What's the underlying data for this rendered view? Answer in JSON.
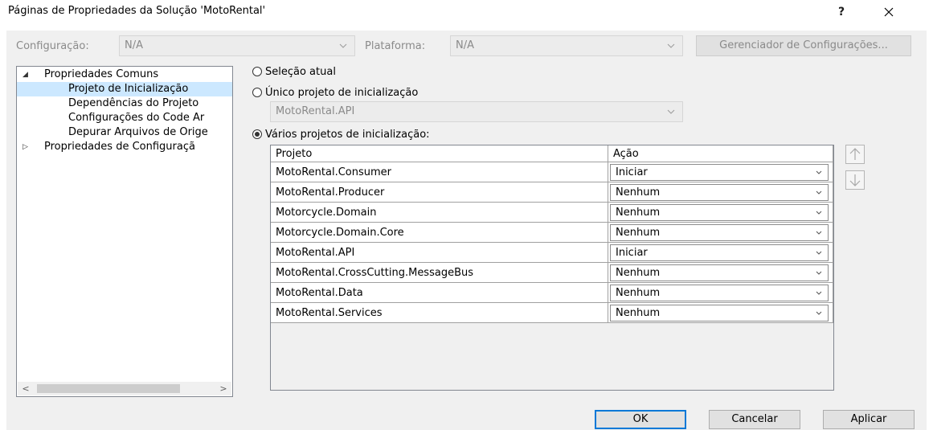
{
  "window": {
    "title": "Páginas de Propriedades da Solução 'MotoRental'",
    "help_label": "?"
  },
  "toolbar": {
    "config_label": "Configuração:",
    "config_value": "N/A",
    "platform_label": "Plataforma:",
    "platform_value": "N/A",
    "config_manager_label": "Gerenciador de Configurações..."
  },
  "tree": {
    "common": "Propriedades Comuns",
    "items": [
      "Projeto de Inicialização",
      "Dependências do Projeto",
      "Configurações do Code Ar",
      "Depurar Arquivos de Orige"
    ],
    "config": "Propriedades de Configuraçã",
    "selected_index": 0,
    "scroll_left": "<",
    "scroll_right": ">"
  },
  "startup": {
    "current_selection": "Seleção atual",
    "single_project": "Único projeto de inicialização",
    "single_project_value": "MotoRental.API",
    "multiple_projects": "Vários projetos de inicialização:",
    "selected_option": "multiple"
  },
  "grid": {
    "col_project": "Projeto",
    "col_action": "Ação",
    "rows": [
      {
        "project": "MotoRental.Consumer",
        "action": "Iniciar"
      },
      {
        "project": "MotoRental.Producer",
        "action": "Nenhum"
      },
      {
        "project": "Motorcycle.Domain",
        "action": "Nenhum"
      },
      {
        "project": "Motorcycle.Domain.Core",
        "action": "Nenhum"
      },
      {
        "project": "MotoRental.API",
        "action": "Iniciar"
      },
      {
        "project": "MotoRental.CrossCutting.MessageBus",
        "action": "Nenhum"
      },
      {
        "project": "MotoRental.Data",
        "action": "Nenhum"
      },
      {
        "project": "MotoRental.Services",
        "action": "Nenhum"
      }
    ]
  },
  "buttons": {
    "ok": "OK",
    "cancel": "Cancelar",
    "apply": "Aplicar"
  },
  "icons": {
    "close": "close-icon",
    "up": "arrow-up-icon",
    "down": "arrow-down-icon",
    "chevron": "chevron-down-icon"
  },
  "colors": {
    "selection": "#cce8ff",
    "default_button_border": "#0078d7",
    "client_bg": "#f0f0f0"
  }
}
